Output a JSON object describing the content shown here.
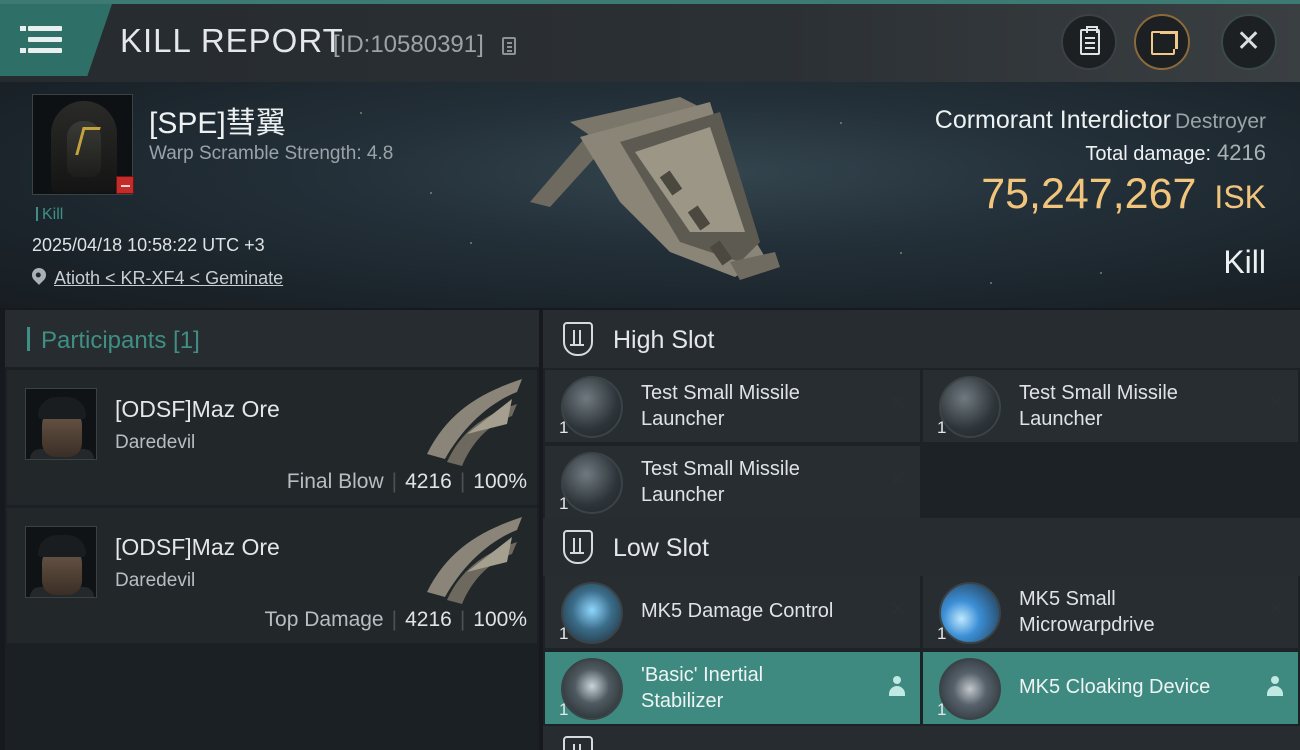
{
  "header": {
    "title": "KILL REPORT",
    "report_id": "[ID:10580391]"
  },
  "victim": {
    "name": "[SPE]彗翼",
    "warp_scramble": "Warp Scramble Strength: 4.8",
    "tag": "Kill",
    "datetime": "2025/04/18 10:58:22 UTC +3",
    "location": "Atioth < KR-XF4 < Geminate"
  },
  "ship": {
    "name": "Cormorant Interdictor",
    "class": "Destroyer",
    "total_damage_label": "Total damage:",
    "total_damage_value": "4216",
    "isk_value": "75,247,267",
    "isk_unit": "ISK",
    "outcome": "Kill"
  },
  "participants": {
    "title": "Participants [1]",
    "items": [
      {
        "name": "[ODSF]Maz Ore",
        "ship": "Daredevil",
        "role": "Final Blow",
        "damage": "4216",
        "percent": "100%"
      },
      {
        "name": "[ODSF]Maz Ore",
        "ship": "Daredevil",
        "role": "Top Damage",
        "damage": "4216",
        "percent": "100%"
      }
    ]
  },
  "fitting": {
    "high_slot": {
      "title": "High Slot",
      "modules": [
        {
          "name": "Test Small Missile Launcher",
          "qty": "1",
          "status": "destroyed"
        },
        {
          "name": "Test Small Missile Launcher",
          "qty": "1",
          "status": "destroyed"
        },
        {
          "name": "Test Small Missile Launcher",
          "qty": "1",
          "status": "destroyed"
        }
      ]
    },
    "low_slot": {
      "title": "Low Slot",
      "modules": [
        {
          "name": "MK5 Damage Control",
          "qty": "1",
          "status": "destroyed"
        },
        {
          "name": "MK5 Small Microwarpdrive",
          "qty": "1",
          "status": "destroyed"
        },
        {
          "name": "'Basic' Inertial Stabilizer",
          "qty": "1",
          "status": "dropped"
        },
        {
          "name": "MK5 Cloaking Device",
          "qty": "1",
          "status": "dropped"
        }
      ]
    }
  },
  "colors": {
    "accent_teal": "#3e8a81",
    "isk_gold": "#f2c57c",
    "loss_red": "#c42b2b"
  }
}
